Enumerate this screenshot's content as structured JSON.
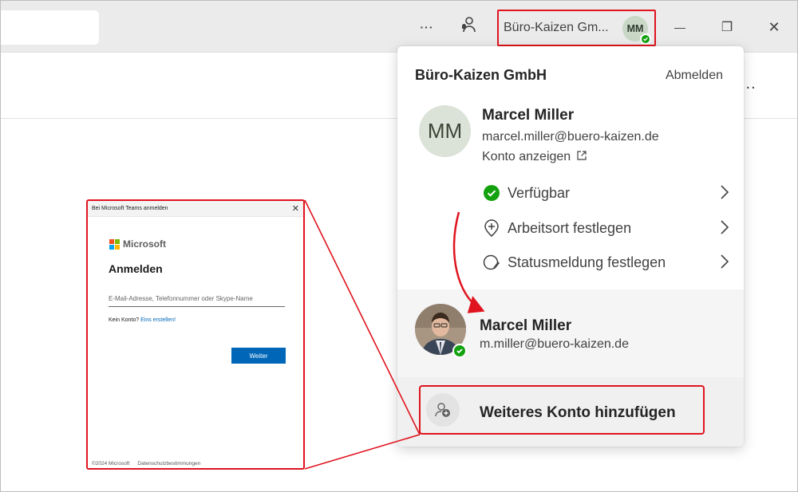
{
  "titlebar": {
    "more_label": "···",
    "account_button_label": "Büro-Kaizen Gm...",
    "avatar_initials": "MM",
    "minimize_label": "—",
    "restore_label": "❐",
    "close_label": "✕"
  },
  "toolbar": {
    "more_label": "..."
  },
  "panel": {
    "org_name": "Büro-Kaizen GmbH",
    "signout_label": "Abmelden",
    "user": {
      "initials": "MM",
      "name": "Marcel Miller",
      "email": "marcel.miller@buero-kaizen.de",
      "view_account_label": "Konto anzeigen"
    },
    "menu": [
      {
        "label": "Verfügbar",
        "icon": "available-icon"
      },
      {
        "label": "Arbeitsort festlegen",
        "icon": "location-add-icon"
      },
      {
        "label": "Statusmeldung festlegen",
        "icon": "status-message-icon"
      }
    ],
    "second_account": {
      "name": "Marcel Miller",
      "email": "m.miller@buero-kaizen.de"
    },
    "add_account_label": "Weiteres Konto hinzufügen"
  },
  "login_dialog": {
    "title": "Bei Microsoft Teams anmelden",
    "close_label": "✕",
    "brand": "Microsoft",
    "heading": "Anmelden",
    "input_placeholder": "E-Mail-Adresse, Telefonnummer oder Skype-Name",
    "no_account_text": "Kein Konto?",
    "create_link": "Eins erstellen!",
    "next_label": "Weiter",
    "footer_copyright": "©2024 Microsoft",
    "footer_privacy": "Datenschutzbestimmungen"
  },
  "colors": {
    "highlight": "#e0141e",
    "available": "#13a10e",
    "microsoft_blue": "#0067b8"
  }
}
